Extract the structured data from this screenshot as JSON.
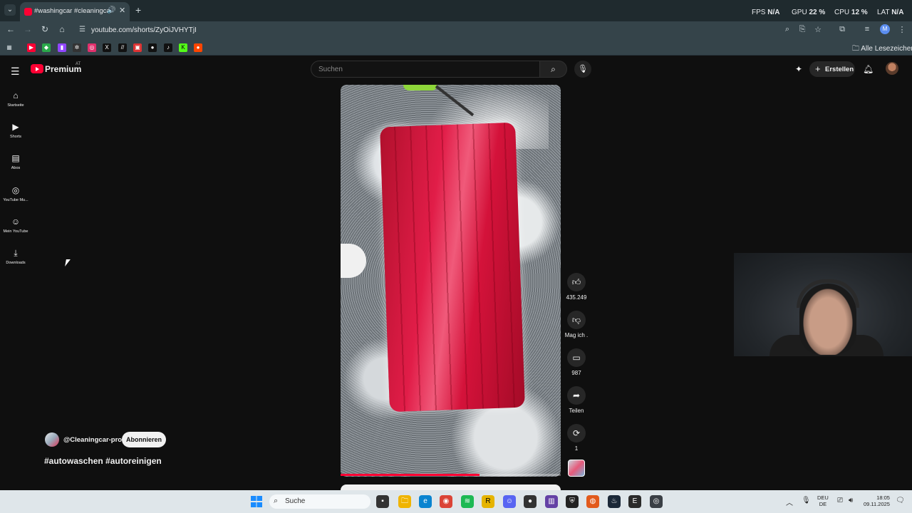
{
  "browser": {
    "tab_title": "#washingcar #cleaningcar",
    "url": "youtube.com/shorts/ZyOiJVHYTjI",
    "bookmarks_folder": "Alle Lesezeichen",
    "stats": {
      "fps_label": "FPS",
      "fps_value": "N/A",
      "gpu_label": "GPU",
      "gpu_value": "22 %",
      "cpu_label": "CPU",
      "cpu_value": "12 %",
      "lat_label": "LAT",
      "lat_value": "N/A"
    },
    "profile_initial": "M"
  },
  "youtube": {
    "logo_text": "Premium",
    "logo_region": "AT",
    "search_placeholder": "Suchen",
    "create_label": "Erstellen",
    "sidebar": [
      {
        "label": "Startseite",
        "icon": "⌂"
      },
      {
        "label": "Shorts",
        "icon": "▶"
      },
      {
        "label": "Abos",
        "icon": "▤"
      },
      {
        "label": "YouTube Mu...",
        "icon": "◎"
      },
      {
        "label": "Mein YouTube",
        "icon": "☺"
      },
      {
        "label": "Downloads",
        "icon": "⤓"
      }
    ],
    "actions": {
      "likes": "435.249",
      "dislike_label": "Mag ich .",
      "comments": "987",
      "share_label": "Teilen",
      "remix": "1"
    },
    "channel": "@Cleaningcar-pro",
    "subscribe_label": "Abonnieren",
    "short_title": "#autowaschen #autoreinigen",
    "progress_fraction": 0.63
  },
  "taskbar": {
    "search_placeholder": "Suche",
    "lang_top": "DEU",
    "lang_bottom": "DE",
    "time": "18:05",
    "date": "09.11.2025"
  },
  "colors": {
    "accent": "#ff0033",
    "chrome_bg": "#35444a",
    "page_bg": "#0f0f0f"
  }
}
